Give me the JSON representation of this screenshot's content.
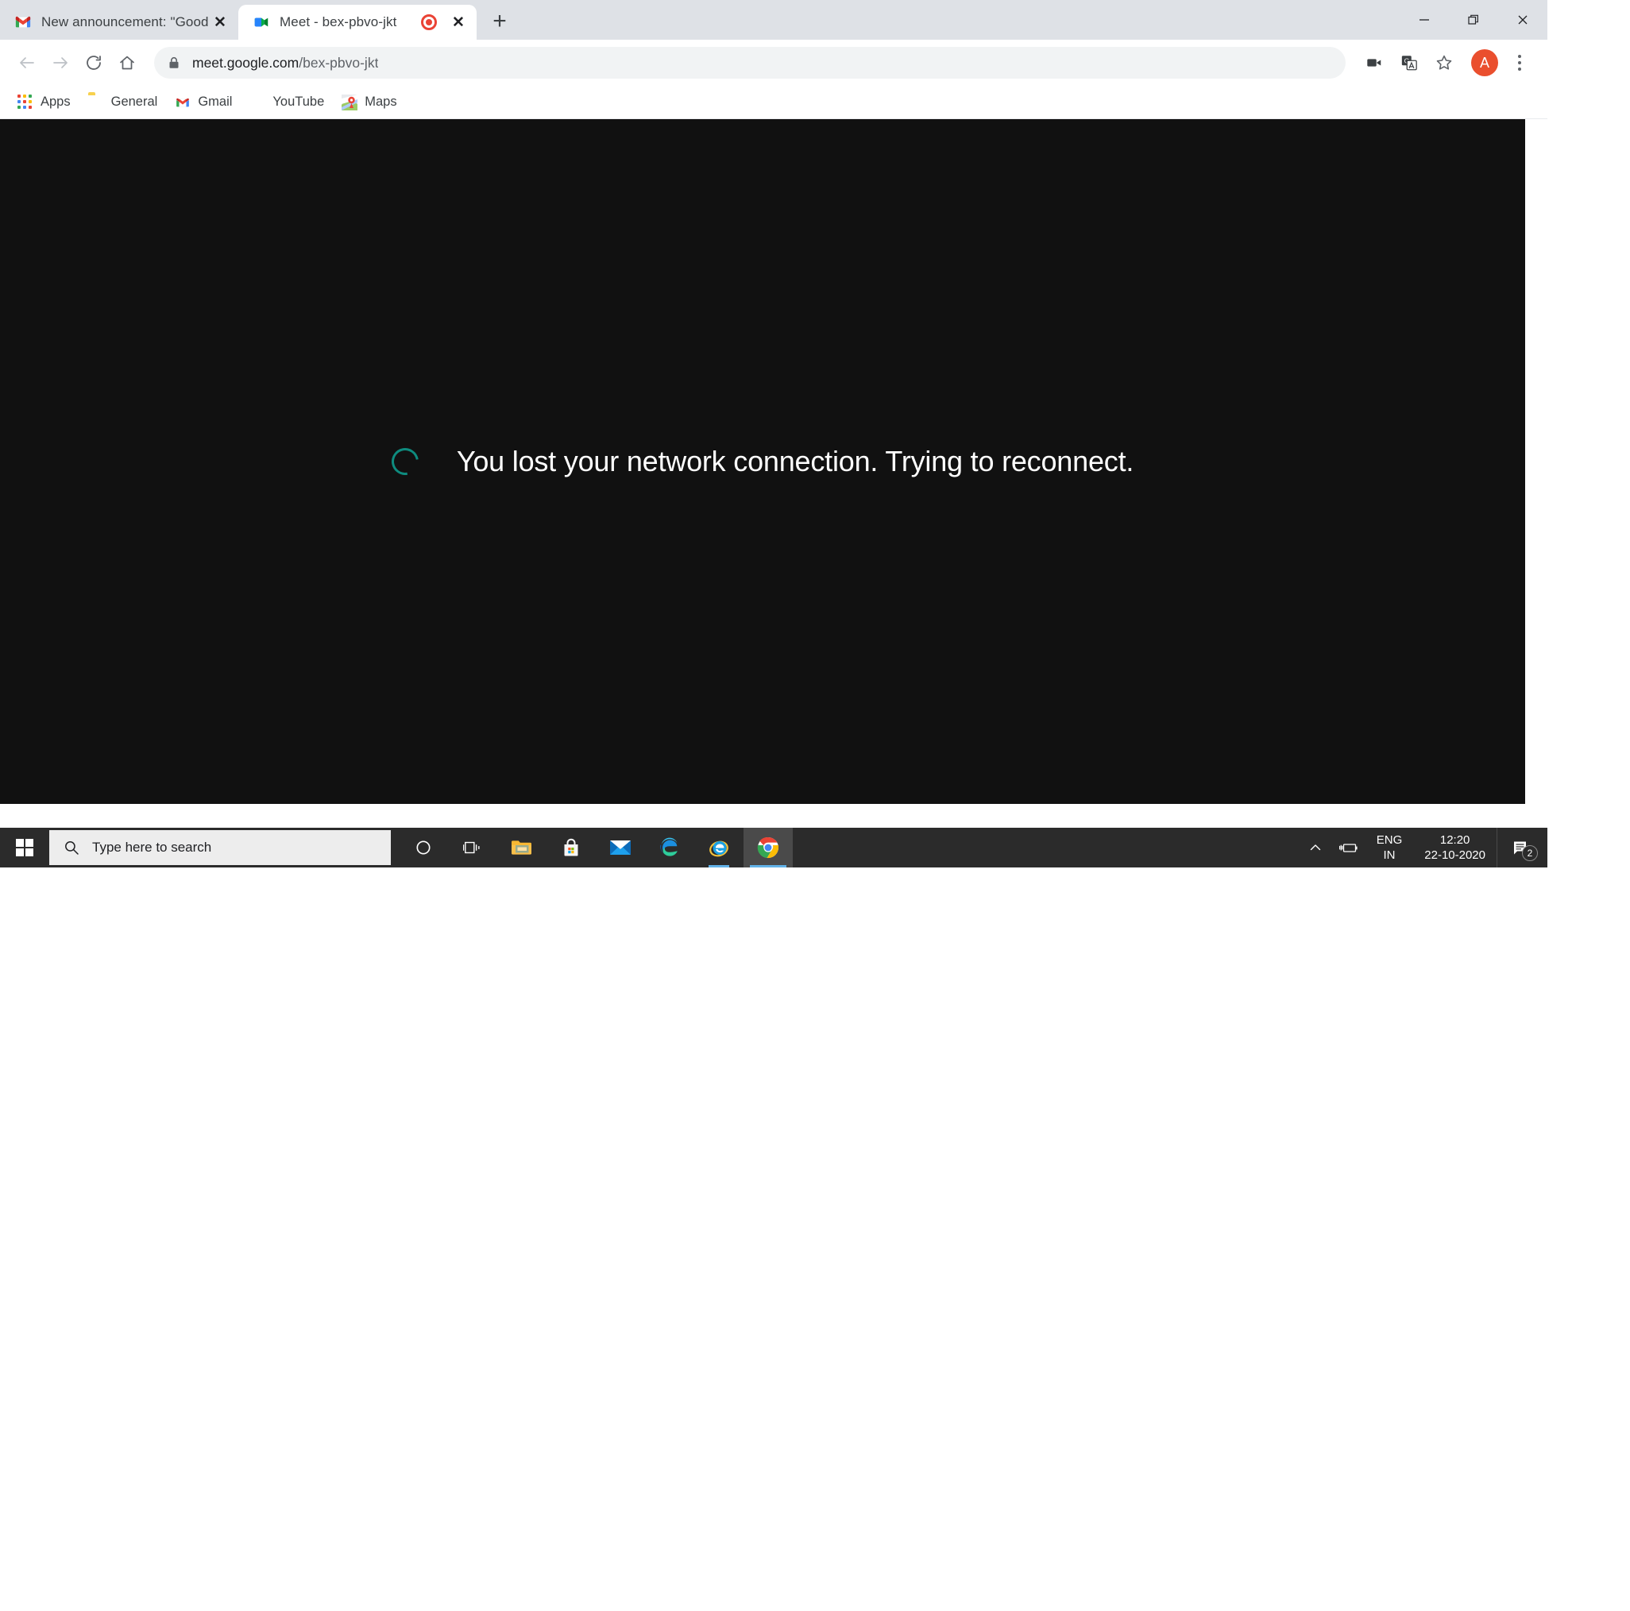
{
  "window": {
    "controls": {
      "minimize": "minimize-button",
      "restore": "restore-button",
      "close": "close-button"
    }
  },
  "tabs": [
    {
      "title": "New announcement: \"Good after",
      "favicon": "gmail-icon",
      "active": false,
      "recording": false,
      "close_label": "✕"
    },
    {
      "title": "Meet - bex-pbvo-jkt",
      "favicon": "google-meet-icon",
      "active": true,
      "recording": true,
      "close_label": "✕"
    }
  ],
  "new_tab_label": "+",
  "toolbar": {
    "back": "back-button",
    "forward": "forward-button",
    "reload": "reload-button",
    "home": "home-button",
    "url_host": "meet.google.com",
    "url_path": "/bex-pbvo-jkt",
    "url_full": "meet.google.com/bex-pbvo-jkt",
    "lock": "site-security-lock-icon",
    "media_icon": "video-camera-icon",
    "translate_icon": "google-translate-icon",
    "bookmark_icon": "star-icon",
    "avatar_letter": "A",
    "avatar_color": "#ea4f2e",
    "menu": "chrome-menu-icon"
  },
  "bookmarks": [
    {
      "label": "Apps",
      "icon": "apps-grid-icon"
    },
    {
      "label": "General",
      "icon": "folder-icon"
    },
    {
      "label": "Gmail",
      "icon": "gmail-icon"
    },
    {
      "label": "YouTube",
      "icon": "youtube-icon"
    },
    {
      "label": "Maps",
      "icon": "google-maps-icon"
    }
  ],
  "page": {
    "background_color": "#111111",
    "spinner_color": "#0e8b7e",
    "message": "You lost your network connection. Trying to reconnect."
  },
  "taskbar": {
    "start": "windows-start-icon",
    "search_placeholder": "Type here to search",
    "apps": [
      {
        "name": "cortana-icon",
        "open": false,
        "active": false
      },
      {
        "name": "task-view-icon",
        "open": false,
        "active": false
      },
      {
        "name": "file-explorer-icon",
        "open": false,
        "active": false
      },
      {
        "name": "microsoft-store-icon",
        "open": false,
        "active": false
      },
      {
        "name": "mail-icon",
        "open": false,
        "active": false
      },
      {
        "name": "microsoft-edge-icon",
        "open": false,
        "active": false
      },
      {
        "name": "internet-explorer-icon",
        "open": true,
        "active": false
      },
      {
        "name": "google-chrome-icon",
        "open": true,
        "active": true
      }
    ],
    "tray": {
      "show_hidden": "chevron-up-icon",
      "battery": "battery-charging-icon",
      "language_top": "ENG",
      "language_bottom": "IN",
      "time": "12:20",
      "date": "22-10-2020",
      "action_center": "action-center-icon",
      "notification_count": "2"
    }
  }
}
